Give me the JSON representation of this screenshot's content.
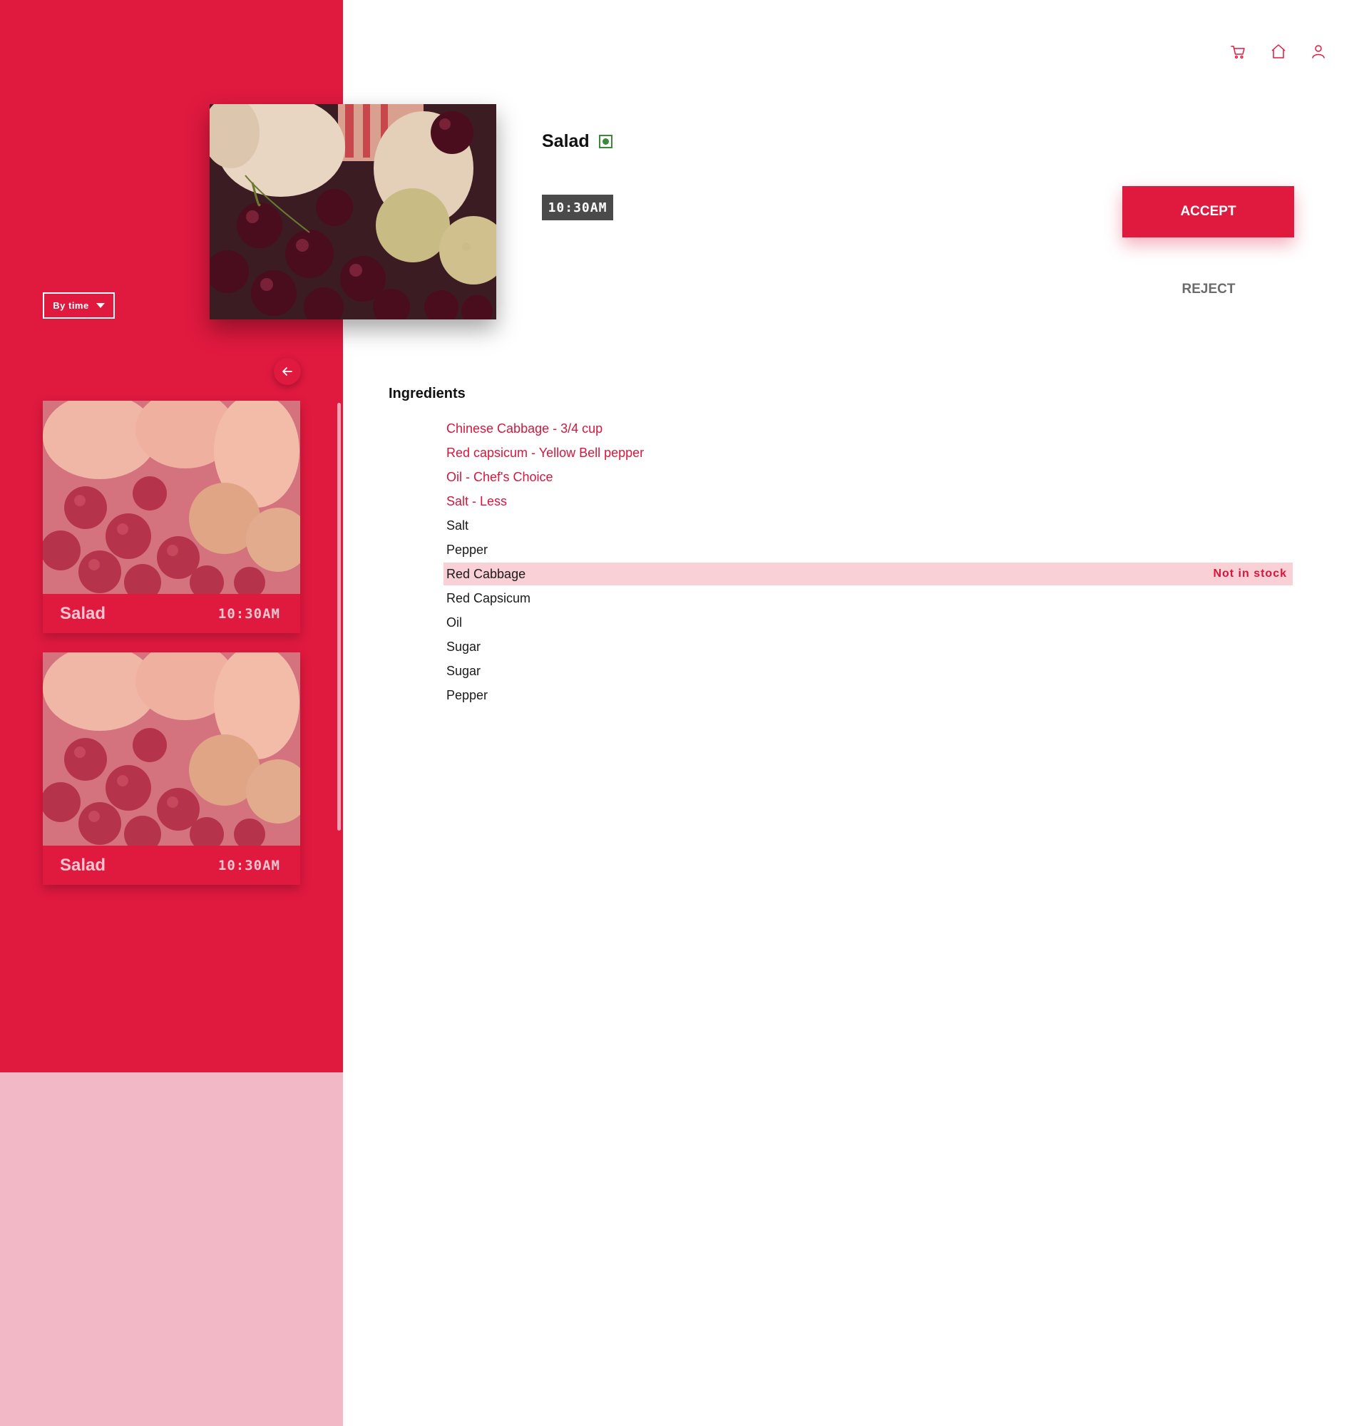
{
  "colors": {
    "accent": "#e0193f",
    "sidebar_bottom": "#f3b8c6",
    "veg_green": "#3a8a3a",
    "time_badge_bg": "#4a4a4a",
    "out_of_stock_bg": "#f8d0d5"
  },
  "header": {
    "icons": [
      "cart-icon",
      "home-icon",
      "user-icon"
    ]
  },
  "sidebar": {
    "sort_label": "By time",
    "back_icon": "arrow-left-icon",
    "orders": [
      {
        "title": "Salad",
        "time": "10:30AM"
      },
      {
        "title": "Salad",
        "time": "10:30AM"
      }
    ]
  },
  "detail": {
    "title": "Salad",
    "veg_icon": "veg-mark-icon",
    "time": "10:30AM",
    "accept_label": "ACCEPT",
    "reject_label": "REJECT",
    "ingredients_heading": "Ingredients",
    "ingredients": [
      {
        "name": "Chinese Cabbage - 3/4 cup",
        "special": true
      },
      {
        "name": "Red capsicum - Yellow Bell pepper",
        "special": true
      },
      {
        "name": "Oil - Chef's Choice",
        "special": true
      },
      {
        "name": "Salt - Less",
        "special": true
      },
      {
        "name": "Salt"
      },
      {
        "name": "Pepper"
      },
      {
        "name": "Red Cabbage",
        "status": "Not in stock"
      },
      {
        "name": "Red Capsicum"
      },
      {
        "name": "Oil"
      },
      {
        "name": "Sugar"
      },
      {
        "name": "Sugar"
      },
      {
        "name": "Pepper"
      }
    ]
  }
}
